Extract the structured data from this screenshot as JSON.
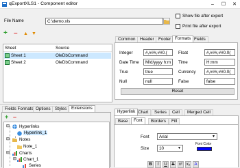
{
  "window": {
    "title": "qExportXLS1 - Component editor",
    "min": "–",
    "max": "☐",
    "close": "✕"
  },
  "file": {
    "label": "File Name",
    "value": "C:\\demo.xls",
    "show_after_export": "Show file after export",
    "print_after_export": "Print file after export"
  },
  "toolbar": {
    "add": "+",
    "remove": "–",
    "up": "▲",
    "down": "▼"
  },
  "sheets": {
    "columns": [
      "Sheet",
      "Source"
    ],
    "rows": [
      {
        "sheet": "Sheet 1",
        "source": "OleDbCommand"
      },
      {
        "sheet": "Sheet 2",
        "source": "OleDbCommand"
      }
    ]
  },
  "formats_tabs": [
    "Common",
    "Header",
    "Footer",
    "Formats",
    "Fields"
  ],
  "formats": {
    "integer": {
      "label": "Integer",
      "value": "#,###,##0.("
    },
    "float": {
      "label": "Float",
      "value": "#,###,##0.0("
    },
    "datetime": {
      "label": "Date Time",
      "value": "M/d/yyyy h:m"
    },
    "time": {
      "label": "Time",
      "value": "H:mm"
    },
    "true": {
      "label": "True",
      "value": "true"
    },
    "currency": {
      "label": "Currency",
      "value": "#,###,##0.0("
    },
    "null": {
      "label": "Null",
      "value": "null"
    },
    "false": {
      "label": "False",
      "value": "false"
    },
    "reset": "Reset"
  },
  "bottom_left_tabs": [
    "Fields Formats",
    "Options",
    "Styles",
    "Extensions"
  ],
  "tree": {
    "hyperlinks": "Hyperlinks",
    "hyperlink_1": "Hyperlink_1",
    "notes": "Notes",
    "note_1": "Note_1",
    "charts": "Charts",
    "chart_1": "Chart_1",
    "series": "Series"
  },
  "bottom_right_tabs": [
    "Hyperlink",
    "Chart",
    "Series",
    "Cell",
    "Merged Cell"
  ],
  "cell_tabs": [
    "Base",
    "Font",
    "Borders",
    "Fill"
  ],
  "font": {
    "font_label": "Font",
    "font_value": "Arial",
    "size_label": "Size",
    "size_value": "10",
    "color_label": "Font Color",
    "color": "#0000ff"
  },
  "style_buttons": [
    "B",
    "I",
    "U",
    "S",
    "x²",
    "x₂",
    "A"
  ]
}
